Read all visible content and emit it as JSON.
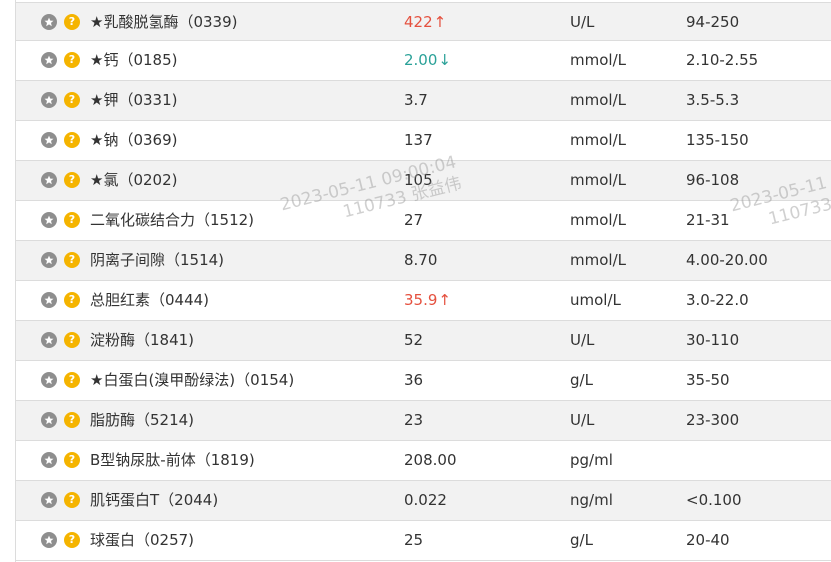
{
  "rows": [
    {
      "name": "★乳酸脱氢酶（0339)",
      "result": "422",
      "flag": "↑",
      "flag_type": "up",
      "unit": "U/L",
      "ref": "94-250"
    },
    {
      "name": "★钙（0185)",
      "result": "2.00",
      "flag": "↓",
      "flag_type": "down",
      "unit": "mmol/L",
      "ref": "2.10-2.55"
    },
    {
      "name": "★钾（0331)",
      "result": "3.7",
      "flag": "",
      "flag_type": "",
      "unit": "mmol/L",
      "ref": "3.5-5.3"
    },
    {
      "name": "★钠（0369)",
      "result": "137",
      "flag": "",
      "flag_type": "",
      "unit": "mmol/L",
      "ref": "135-150"
    },
    {
      "name": "★氯（0202)",
      "result": "105",
      "flag": "",
      "flag_type": "",
      "unit": "mmol/L",
      "ref": "96-108"
    },
    {
      "name": "二氧化碳结合力（1512)",
      "result": "27",
      "flag": "",
      "flag_type": "",
      "unit": "mmol/L",
      "ref": "21-31"
    },
    {
      "name": "阴离子间隙（1514)",
      "result": "8.70",
      "flag": "",
      "flag_type": "",
      "unit": "mmol/L",
      "ref": "4.00-20.00"
    },
    {
      "name": "总胆红素（0444)",
      "result": "35.9",
      "flag": "↑",
      "flag_type": "up",
      "unit": "umol/L",
      "ref": "3.0-22.0"
    },
    {
      "name": "淀粉酶（1841)",
      "result": "52",
      "flag": "",
      "flag_type": "",
      "unit": "U/L",
      "ref": "30-110"
    },
    {
      "name": "★白蛋白(溴甲酚绿法)（0154)",
      "result": "36",
      "flag": "",
      "flag_type": "",
      "unit": "g/L",
      "ref": "35-50"
    },
    {
      "name": "脂肪酶（5214)",
      "result": "23",
      "flag": "",
      "flag_type": "",
      "unit": "U/L",
      "ref": "23-300"
    },
    {
      "name": "B型钠尿肽-前体（1819)",
      "result": "208.00",
      "flag": "",
      "flag_type": "",
      "unit": "pg/ml",
      "ref": ""
    },
    {
      "name": "肌钙蛋白T（2044)",
      "result": "0.022",
      "flag": "",
      "flag_type": "",
      "unit": "ng/ml",
      "ref": "<0.100"
    },
    {
      "name": "球蛋白（0257)",
      "result": "25",
      "flag": "",
      "flag_type": "",
      "unit": "g/L",
      "ref": "20-40"
    }
  ],
  "icons": {
    "star": "star-icon",
    "help": "help-icon",
    "help_glyph": "?"
  },
  "colors": {
    "high": "#e5513f",
    "low": "#2aa198",
    "help": "#f5b400",
    "star": "#8e8e8e"
  },
  "watermark": {
    "line1": "2023-05-11 09:00:04",
    "line2": "110733 张益伟",
    "line1_cut": "2023-05-11",
    "line2_cut": "110733"
  }
}
